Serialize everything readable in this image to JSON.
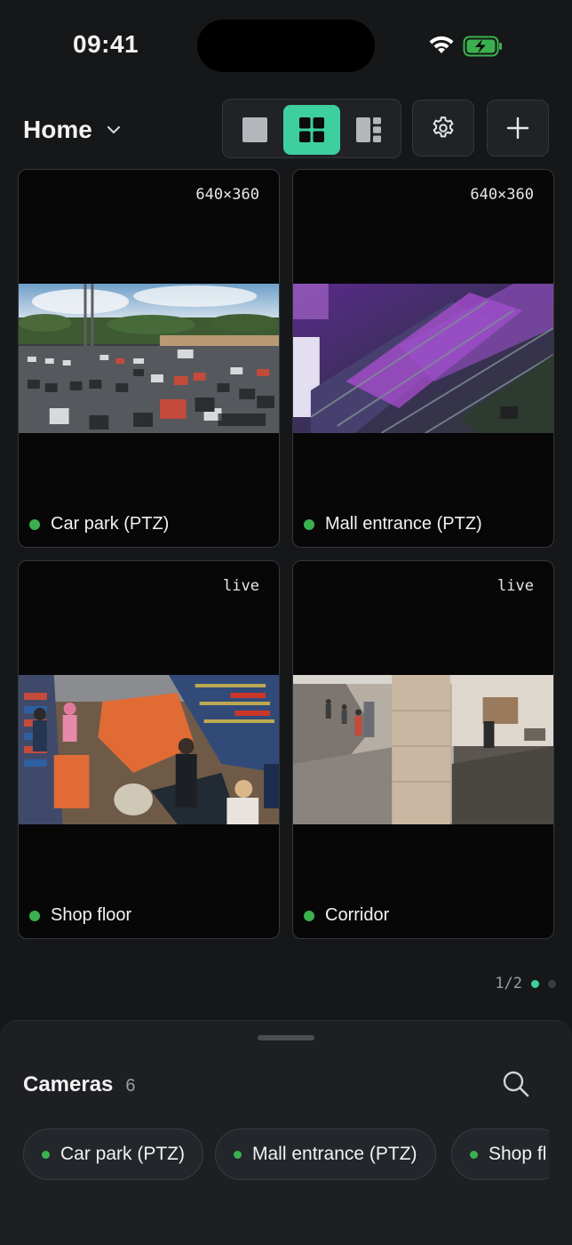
{
  "status_bar": {
    "time": "09:41"
  },
  "header": {
    "title": "Home",
    "layout_options": [
      "single-view",
      "grid-view",
      "split-view"
    ],
    "active_layout": "grid-view"
  },
  "tiles": [
    {
      "name": "Car park (PTZ)",
      "meta": "640×360",
      "status": "online"
    },
    {
      "name": "Mall entrance (PTZ)",
      "meta": "640×360",
      "status": "online"
    },
    {
      "name": "Shop floor",
      "meta": "live",
      "status": "online"
    },
    {
      "name": "Corridor",
      "meta": "live",
      "status": "online"
    }
  ],
  "pager": {
    "text": "1/2",
    "current": 1,
    "total": 2
  },
  "cameras_sheet": {
    "title": "Cameras",
    "count": "6",
    "chips": [
      "Car park (PTZ)",
      "Mall entrance (PTZ)",
      "Shop fl"
    ]
  },
  "colors": {
    "accent": "#3ecf9e",
    "online": "#3bb04f",
    "background": "#161719"
  }
}
